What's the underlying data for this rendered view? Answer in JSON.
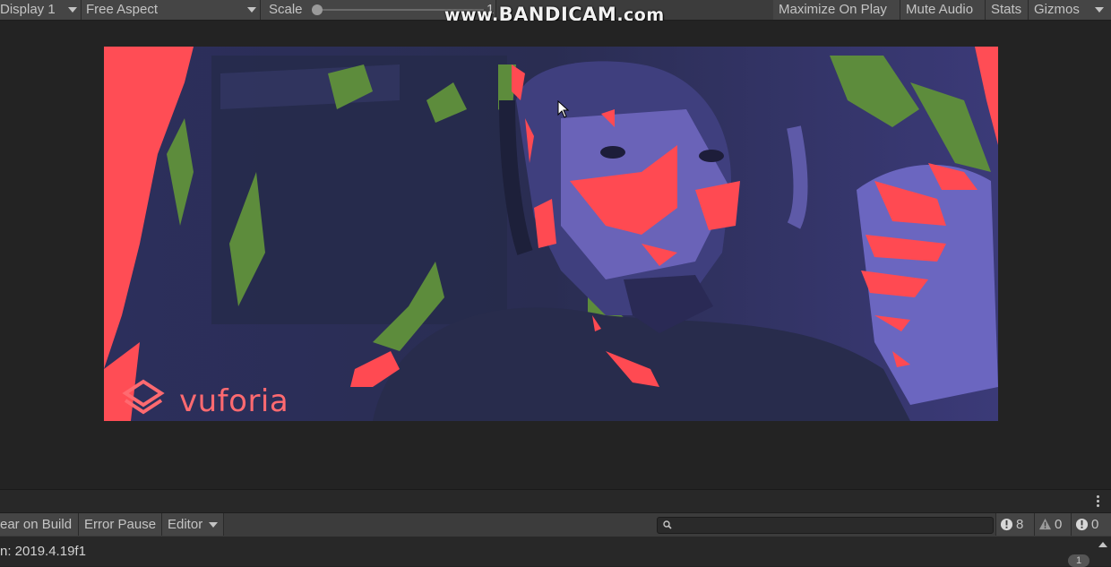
{
  "game_toolbar": {
    "display_label": "Display 1",
    "aspect_label": "Free Aspect",
    "scale_label": "Scale",
    "scale_value": "1",
    "maximize_label": "Maximize On Play",
    "mute_label": "Mute Audio",
    "stats_label": "Stats",
    "gizmos_label": "Gizmos"
  },
  "watermark": {
    "prefix": "www.",
    "brand": "BANDICAM",
    "suffix": ".com"
  },
  "game_view": {
    "logo_text": "vuforia"
  },
  "console_toolbar": {
    "clear_on_build_label": "ear on Build",
    "error_pause_label": "Error Pause",
    "editor_label": "Editor",
    "search_value": "",
    "log_count": "8",
    "warning_count": "0",
    "error_count": "0"
  },
  "console": {
    "log_line": "n: 2019.4.19f1",
    "collapse_count": "1"
  },
  "colors": {
    "accent_red": "#ff4a52",
    "accent_purple": "#6a62b8",
    "accent_green": "#5a8a3e"
  }
}
